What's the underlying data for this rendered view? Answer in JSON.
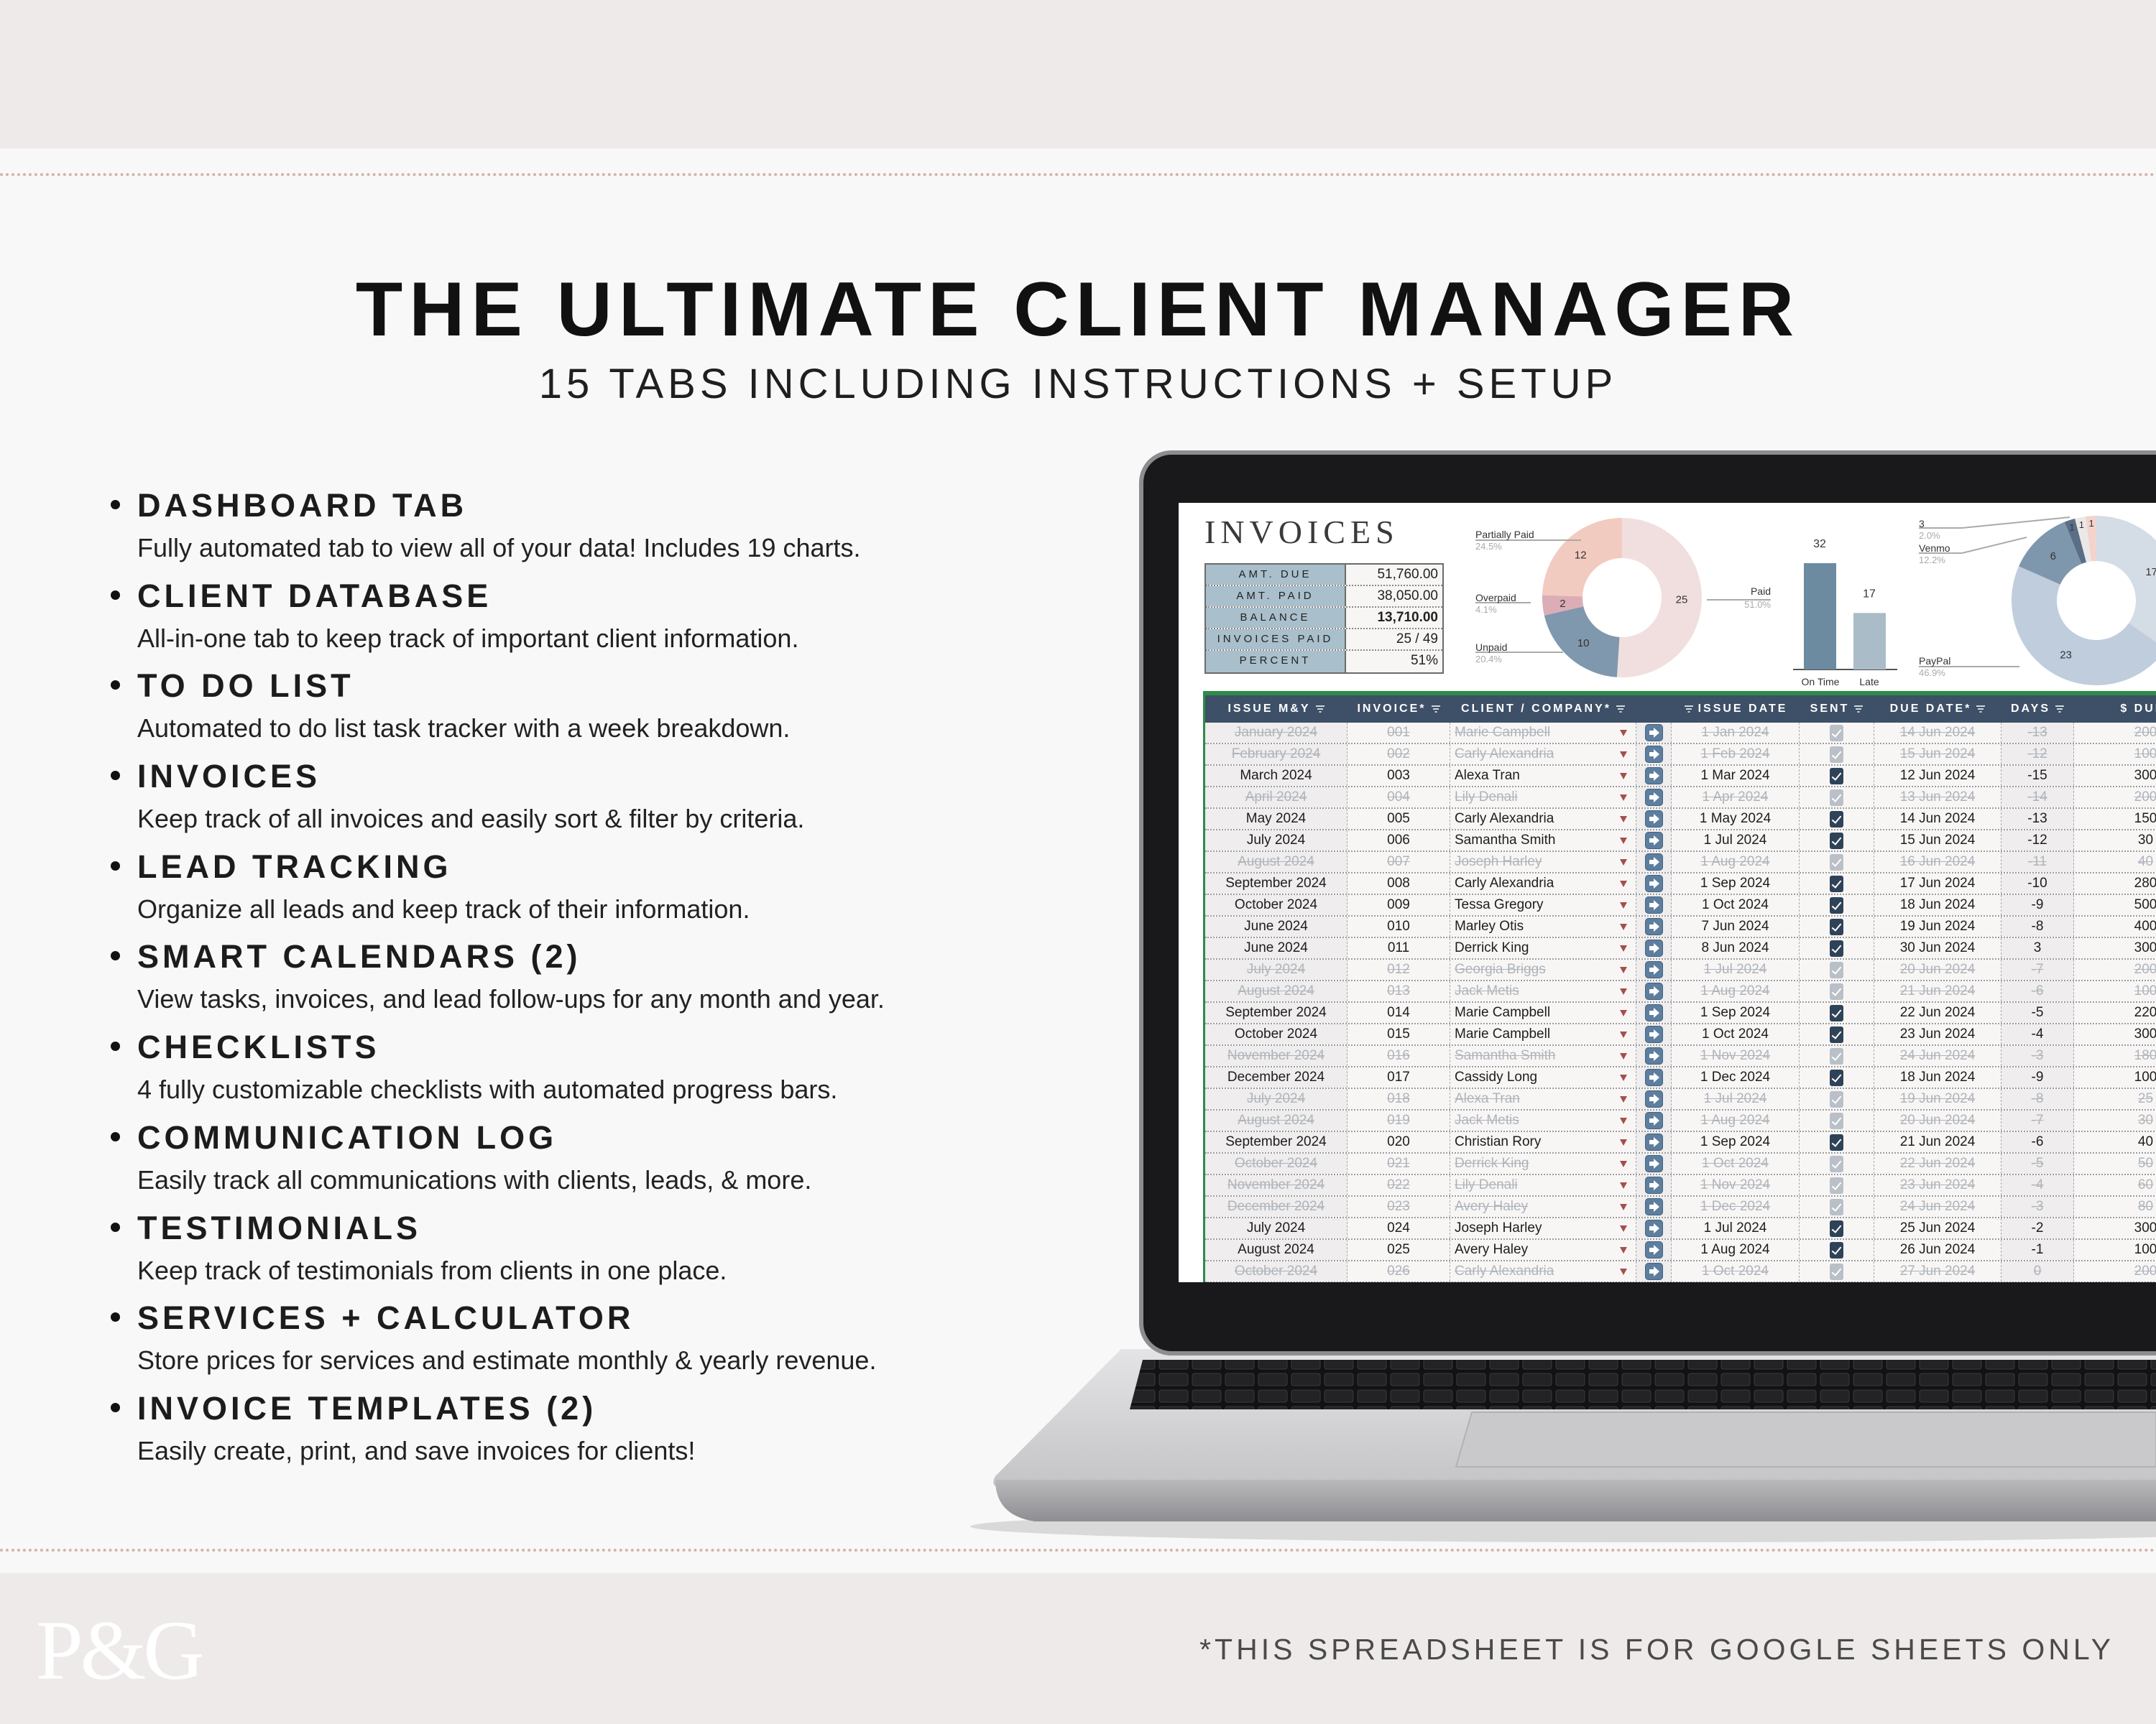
{
  "header": {
    "title": "THE ULTIMATE CLIENT MANAGER",
    "subtitle": "15 TABS INCLUDING INSTRUCTIONS + SETUP"
  },
  "features": [
    {
      "title": "DASHBOARD TAB",
      "desc": "Fully automated tab to view all of your data! Includes 19 charts."
    },
    {
      "title": "CLIENT DATABASE",
      "desc": "All-in-one tab to keep track of important client information."
    },
    {
      "title": "TO DO LIST",
      "desc": "Automated to do list task tracker with a week breakdown."
    },
    {
      "title": "INVOICES",
      "desc": "Keep track of all invoices and easily sort & filter by criteria."
    },
    {
      "title": "LEAD TRACKING",
      "desc": "Organize all leads and keep track of their information."
    },
    {
      "title": "SMART CALENDARS (2)",
      "desc": "View tasks, invoices, and lead follow-ups for any month and year."
    },
    {
      "title": "CHECKLISTS",
      "desc": "4 fully customizable checklists with automated progress bars."
    },
    {
      "title": "COMMUNICATION LOG",
      "desc": "Easily track all communications with clients, leads, & more."
    },
    {
      "title": "TESTIMONIALS",
      "desc": "Keep track of testimonials from clients in one place."
    },
    {
      "title": "SERVICES + CALCULATOR",
      "desc": "Store prices for services and estimate monthly & yearly revenue."
    },
    {
      "title": "INVOICE TEMPLATES (2)",
      "desc": "Easily create, print, and save invoices for clients!"
    }
  ],
  "footer": {
    "note": "*THIS SPREADSHEET IS FOR GOOGLE SHEETS ONLY",
    "logo": "P&G"
  },
  "sheet": {
    "title": "INVOICES",
    "summary": [
      {
        "label": "AMT. DUE",
        "value": "51,760.00"
      },
      {
        "label": "AMT. PAID",
        "value": "38,050.00"
      },
      {
        "label": "BALANCE",
        "value": "13,710.00"
      },
      {
        "label": "INVOICES PAID",
        "value": "25 / 49"
      },
      {
        "label": "PERCENT",
        "value": "51%"
      }
    ],
    "columns": [
      "ISSUE M&Y",
      "INVOICE*",
      "CLIENT / COMPANY*",
      "",
      "ISSUE DATE",
      "SENT",
      "DUE DATE*",
      "DAYS",
      "$ DUE*"
    ],
    "rows": [
      {
        "my": "January 2024",
        "inv": "001",
        "client": "Marie Campbell",
        "issue": "1 Jan 2024",
        "sent": true,
        "due": "14 Jun 2024",
        "days": "-13",
        "amt": "200",
        "paid": true
      },
      {
        "my": "February 2024",
        "inv": "002",
        "client": "Carly Alexandria",
        "issue": "1 Feb 2024",
        "sent": true,
        "due": "15 Jun 2024",
        "days": "-12",
        "amt": "100",
        "paid": true
      },
      {
        "my": "March 2024",
        "inv": "003",
        "client": "Alexa Tran",
        "issue": "1 Mar 2024",
        "sent": true,
        "due": "12 Jun 2024",
        "days": "-15",
        "amt": "300",
        "paid": false
      },
      {
        "my": "April 2024",
        "inv": "004",
        "client": "Lily Denali",
        "issue": "1 Apr 2024",
        "sent": true,
        "due": "13 Jun 2024",
        "days": "-14",
        "amt": "200",
        "paid": true
      },
      {
        "my": "May 2024",
        "inv": "005",
        "client": "Carly Alexandria",
        "issue": "1 May 2024",
        "sent": true,
        "due": "14 Jun 2024",
        "days": "-13",
        "amt": "150",
        "paid": false
      },
      {
        "my": "July 2024",
        "inv": "006",
        "client": "Samantha Smith",
        "issue": "1 Jul 2024",
        "sent": true,
        "due": "15 Jun 2024",
        "days": "-12",
        "amt": "30",
        "paid": false
      },
      {
        "my": "August 2024",
        "inv": "007",
        "client": "Joseph Harley",
        "issue": "1 Aug 2024",
        "sent": true,
        "due": "16 Jun 2024",
        "days": "-11",
        "amt": "40",
        "paid": true
      },
      {
        "my": "September 2024",
        "inv": "008",
        "client": "Carly Alexandria",
        "issue": "1 Sep 2024",
        "sent": true,
        "due": "17 Jun 2024",
        "days": "-10",
        "amt": "280",
        "paid": false
      },
      {
        "my": "October 2024",
        "inv": "009",
        "client": "Tessa Gregory",
        "issue": "1 Oct 2024",
        "sent": true,
        "due": "18 Jun 2024",
        "days": "-9",
        "amt": "500",
        "paid": false
      },
      {
        "my": "June 2024",
        "inv": "010",
        "client": "Marley Otis",
        "issue": "7 Jun 2024",
        "sent": true,
        "due": "19 Jun 2024",
        "days": "-8",
        "amt": "400",
        "paid": false
      },
      {
        "my": "June 2024",
        "inv": "011",
        "client": "Derrick King",
        "issue": "8 Jun 2024",
        "sent": true,
        "due": "30 Jun 2024",
        "days": "3",
        "amt": "300",
        "paid": false
      },
      {
        "my": "July 2024",
        "inv": "012",
        "client": "Georgia Briggs",
        "issue": "1 Jul 2024",
        "sent": true,
        "due": "20 Jun 2024",
        "days": "-7",
        "amt": "200",
        "paid": true
      },
      {
        "my": "August 2024",
        "inv": "013",
        "client": "Jack Metis",
        "issue": "1 Aug 2024",
        "sent": true,
        "due": "21 Jun 2024",
        "days": "-6",
        "amt": "100",
        "paid": true
      },
      {
        "my": "September 2024",
        "inv": "014",
        "client": "Marie Campbell",
        "issue": "1 Sep 2024",
        "sent": true,
        "due": "22 Jun 2024",
        "days": "-5",
        "amt": "220",
        "paid": false
      },
      {
        "my": "October 2024",
        "inv": "015",
        "client": "Marie Campbell",
        "issue": "1 Oct 2024",
        "sent": true,
        "due": "23 Jun 2024",
        "days": "-4",
        "amt": "300",
        "paid": false
      },
      {
        "my": "November 2024",
        "inv": "016",
        "client": "Samantha Smith",
        "issue": "1 Nov 2024",
        "sent": true,
        "due": "24 Jun 2024",
        "days": "-3",
        "amt": "180",
        "paid": true
      },
      {
        "my": "December 2024",
        "inv": "017",
        "client": "Cassidy Long",
        "issue": "1 Dec 2024",
        "sent": true,
        "due": "18 Jun 2024",
        "days": "-9",
        "amt": "100",
        "paid": false
      },
      {
        "my": "July 2024",
        "inv": "018",
        "client": "Alexa Tran",
        "issue": "1 Jul 2024",
        "sent": true,
        "due": "19 Jun 2024",
        "days": "-8",
        "amt": "25",
        "paid": true
      },
      {
        "my": "August 2024",
        "inv": "019",
        "client": "Jack Metis",
        "issue": "1 Aug 2024",
        "sent": true,
        "due": "20 Jun 2024",
        "days": "-7",
        "amt": "30",
        "paid": true
      },
      {
        "my": "September 2024",
        "inv": "020",
        "client": "Christian Rory",
        "issue": "1 Sep 2024",
        "sent": true,
        "due": "21 Jun 2024",
        "days": "-6",
        "amt": "40",
        "paid": false
      },
      {
        "my": "October 2024",
        "inv": "021",
        "client": "Derrick King",
        "issue": "1 Oct 2024",
        "sent": true,
        "due": "22 Jun 2024",
        "days": "-5",
        "amt": "50",
        "paid": true
      },
      {
        "my": "November 2024",
        "inv": "022",
        "client": "Lily Denali",
        "issue": "1 Nov 2024",
        "sent": true,
        "due": "23 Jun 2024",
        "days": "-4",
        "amt": "60",
        "paid": true
      },
      {
        "my": "December 2024",
        "inv": "023",
        "client": "Avery Haley",
        "issue": "1 Dec 2024",
        "sent": true,
        "due": "24 Jun 2024",
        "days": "-3",
        "amt": "80",
        "paid": true
      },
      {
        "my": "July 2024",
        "inv": "024",
        "client": "Joseph Harley",
        "issue": "1 Jul 2024",
        "sent": true,
        "due": "25 Jun 2024",
        "days": "-2",
        "amt": "300",
        "paid": false
      },
      {
        "my": "August 2024",
        "inv": "025",
        "client": "Avery Haley",
        "issue": "1 Aug 2024",
        "sent": true,
        "due": "26 Jun 2024",
        "days": "-1",
        "amt": "100",
        "paid": false
      },
      {
        "my": "October 2024",
        "inv": "026",
        "client": "Carly Alexandria",
        "issue": "1 Oct 2024",
        "sent": true,
        "due": "27 Jun 2024",
        "days": "0",
        "amt": "200",
        "paid": true
      }
    ]
  },
  "chart_data": [
    {
      "type": "pie",
      "slices": [
        {
          "name": "Paid",
          "value": 25,
          "percent": "51.0%",
          "color": "#f1dfdf"
        },
        {
          "name": "Unpaid",
          "value": 10,
          "percent": "20.4%",
          "color": "#8098ad"
        },
        {
          "name": "Overpaid",
          "value": 2,
          "percent": "4.1%",
          "color": "#dcadb7"
        },
        {
          "name": "Partially Paid",
          "value": 12,
          "percent": "24.5%",
          "color": "#f2cbc0"
        }
      ]
    },
    {
      "type": "bar",
      "categories": [
        "On Time",
        "Late"
      ],
      "values": [
        32,
        17
      ],
      "colors": [
        "#6c8aa0",
        "#a9bcc8"
      ]
    },
    {
      "type": "pie",
      "slices": [
        {
          "value": 17,
          "color": "#d4dce6"
        },
        {
          "name": "PayPal",
          "value": 23,
          "percent": "46.9%",
          "color": "#bfcddc"
        },
        {
          "name": "Venmo",
          "value": 6,
          "percent": "12.2%",
          "color": "#7f97ad"
        },
        {
          "value": 1,
          "color": "#5a6f87"
        },
        {
          "name": "3",
          "value": 1,
          "percent": "2.0%",
          "color": "#ece8e8"
        },
        {
          "value": 1,
          "color": "#f3d4cc"
        }
      ]
    }
  ]
}
